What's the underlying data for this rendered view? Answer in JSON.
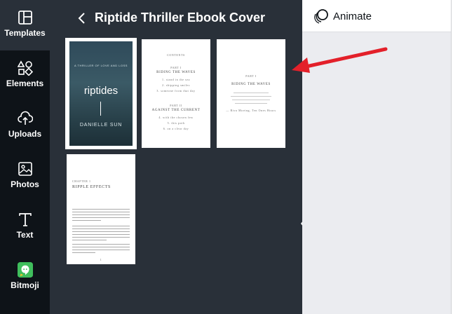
{
  "sidebar": {
    "items": [
      {
        "label": "Templates",
        "icon": "templates-icon",
        "active": true
      },
      {
        "label": "Elements",
        "icon": "elements-icon",
        "active": false
      },
      {
        "label": "Uploads",
        "icon": "upload-cloud-icon",
        "active": false
      },
      {
        "label": "Photos",
        "icon": "image-icon",
        "active": false
      },
      {
        "label": "Text",
        "icon": "text-icon",
        "active": false
      },
      {
        "label": "Bitmoji",
        "icon": "bitmoji-icon",
        "active": false
      }
    ]
  },
  "panel": {
    "title": "Riptide Thriller Ebook Cover",
    "pages": [
      {
        "kind": "cover",
        "tag": "A THRILLER OF LOVE AND LOSS",
        "heading": "riptides",
        "author": "DANIELLE SUN"
      },
      {
        "kind": "contents",
        "header": "CONTENTS",
        "part1": "PART I",
        "part1_title": "RIDING THE WAVES",
        "part1_items": [
          "1. stand in the sea",
          "2. shipping smiles",
          "3. someone from that day"
        ],
        "part2": "PART II",
        "part2_title": "AGAINST THE CURRENT",
        "part2_items": [
          "4. with the chosen few",
          "5. this path",
          "6. on a clear day"
        ]
      },
      {
        "kind": "part",
        "label": "PART I",
        "title": "RIDING THE WAVES",
        "caption": "— Riva Moeing, Ten Ones Hours"
      },
      {
        "kind": "chapter",
        "label": "CHAPTER 1",
        "title": "RIPPLE EFFECTS",
        "page_no": "1"
      }
    ]
  },
  "topbar": {
    "animate_label": "Animate"
  },
  "colors": {
    "rail_bg": "#0e1318",
    "panel_bg": "#293039",
    "canvas_bg": "#ebecf0",
    "arrow": "#e3202a"
  }
}
